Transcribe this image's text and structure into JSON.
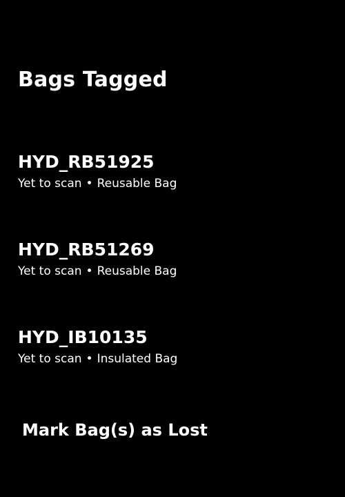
{
  "header": {
    "title": "Bags Tagged"
  },
  "bags": [
    {
      "id": "HYD_RB51925",
      "status": "Yet to scan",
      "separator": "•",
      "type": "Reusable Bag"
    },
    {
      "id": "HYD_RB51269",
      "status": "Yet to scan",
      "separator": "•",
      "type": "Reusable Bag"
    },
    {
      "id": "HYD_IB10135",
      "status": "Yet to scan",
      "separator": "•",
      "type": "Insulated Bag"
    }
  ],
  "actions": {
    "mark_lost_label": "Mark Bag(s) as Lost"
  },
  "colors": {
    "background": "#000000",
    "text": "#ffffff"
  }
}
